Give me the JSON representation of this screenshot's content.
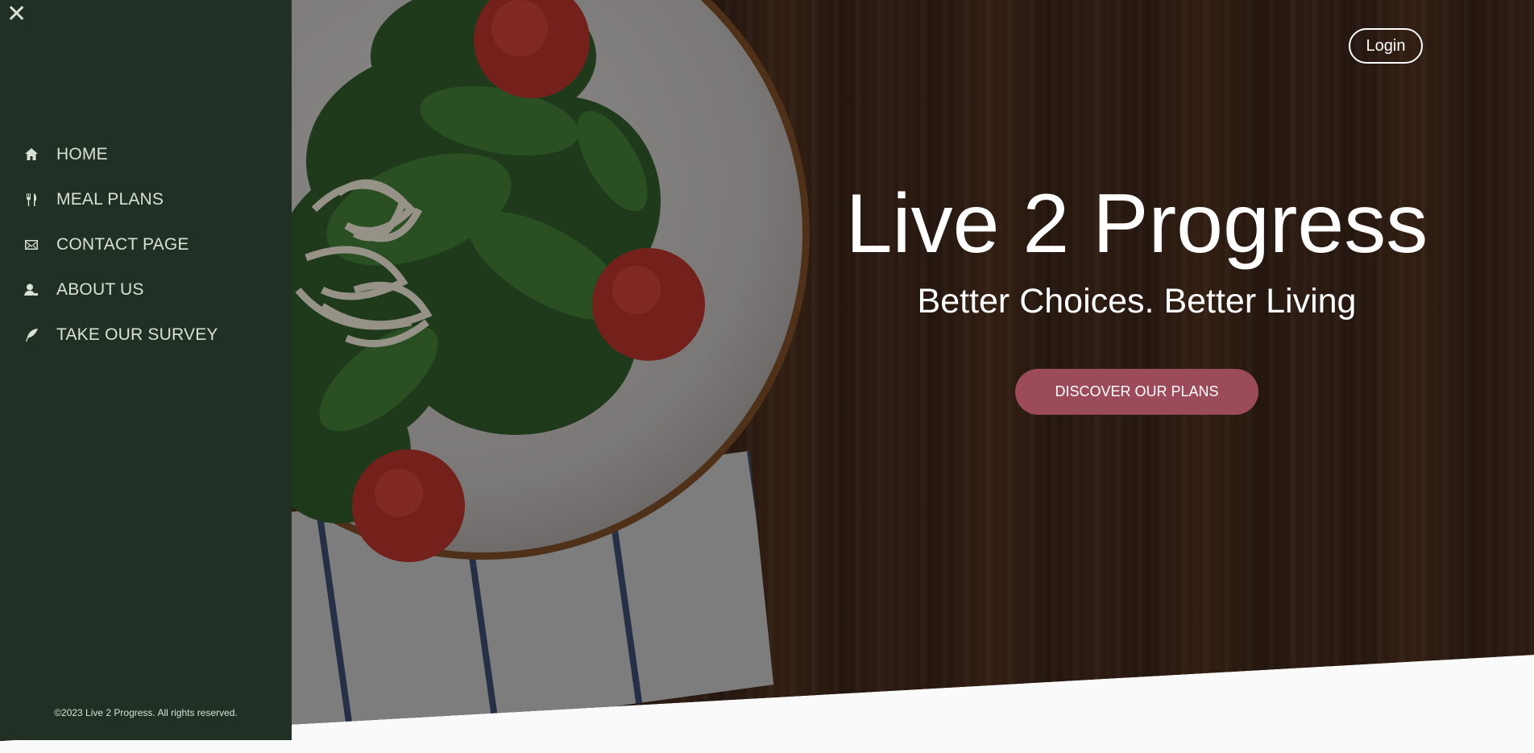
{
  "sidebar": {
    "close_icon": "close-icon",
    "items": [
      {
        "label": "HOME",
        "icon": "home-icon"
      },
      {
        "label": "MEAL PLANS",
        "icon": "fork-knife-icon"
      },
      {
        "label": "CONTACT PAGE",
        "icon": "envelope-icon"
      },
      {
        "label": "ABOUT US",
        "icon": "user-icon"
      },
      {
        "label": "TAKE OUR SURVEY",
        "icon": "feather-icon"
      }
    ],
    "copyright": "©2023 Live 2 Progress. All rights reserved."
  },
  "header": {
    "login_label": "Login"
  },
  "hero": {
    "title": "Live 2 Progress",
    "subtitle": "Better Choices. Better Living",
    "cta_label": "DISCOVER OUR PLANS"
  },
  "colors": {
    "sidebar_bg": "#213024",
    "sidebar_text": "#d9e1d5",
    "cta_bg": "#9c4b5a",
    "page_bg": "#fafafa"
  }
}
